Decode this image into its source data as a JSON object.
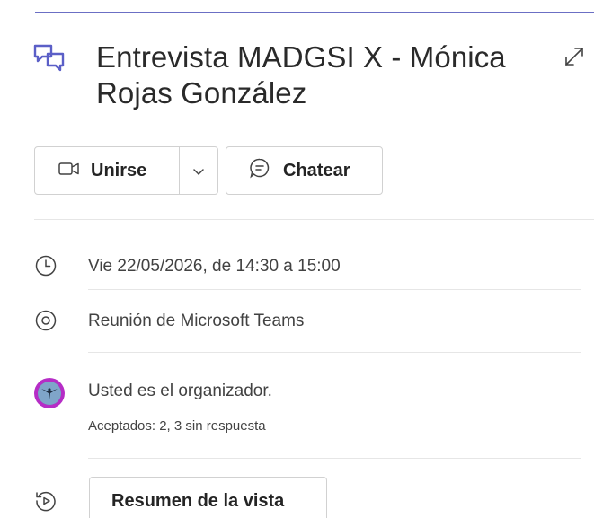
{
  "event": {
    "title_line1": "Entrevista MADGSI X - Mónica",
    "title_line2": "Rojas González"
  },
  "actions": {
    "join_label": "Unirse",
    "chat_label": "Chatear"
  },
  "details": {
    "datetime": "Vie 22/05/2026, de 14:30 a 15:00",
    "location": "Reunión de Microsoft Teams",
    "organizer_text": "Usted es el organizador.",
    "responses": "Aceptados: 2, 3 sin respuesta",
    "summary_label": "Resumen de la vista"
  },
  "icons": {
    "header": "chat-bubbles-icon",
    "expand": "expand-icon",
    "join": "video-camera-icon",
    "caret": "chevron-down-icon",
    "chat": "chat-bubble-icon",
    "time": "clock-icon",
    "location": "location-pin-icon",
    "summary": "replay-icon"
  },
  "colors": {
    "accent": "#6b6fc4",
    "avatar_ring": "#b62dc6",
    "text": "#242424",
    "muted": "#424242",
    "divider": "#e6e6e6"
  }
}
